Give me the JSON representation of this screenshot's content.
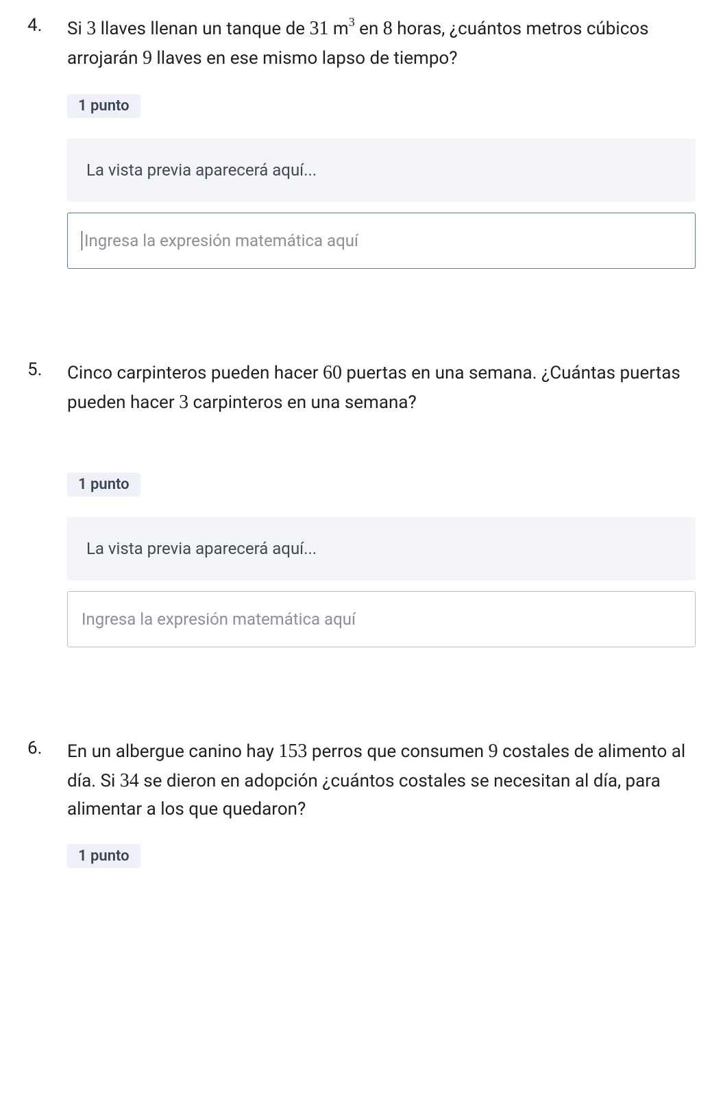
{
  "questions": [
    {
      "number": "4.",
      "text_parts": {
        "p1": "Si ",
        "n1": "3",
        "p2": " llaves llenan un tanque de ",
        "n2": "31",
        "p3": " m",
        "sup": "3",
        "p4": " en ",
        "n3": "8",
        "p5": " horas, ¿cuántos metros cúbicos arrojarán ",
        "n4": "9",
        "p6": " llaves en ese mismo lapso de tiempo?"
      },
      "points": "1 punto",
      "preview": "La vista previa aparecerá aquí...",
      "placeholder": "Ingresa la expresión matemática aquí",
      "active": true
    },
    {
      "number": "5.",
      "text_parts": {
        "p1": "Cinco carpinteros pueden hacer ",
        "n1": "60",
        "p2": " puertas en una semana. ¿Cuántas puertas pueden hacer ",
        "n2": "3",
        "p3": " carpinteros en una semana?"
      },
      "points": "1 punto",
      "preview": "La vista previa aparecerá aquí...",
      "placeholder": "Ingresa la expresión matemática aquí",
      "active": false
    },
    {
      "number": "6.",
      "text_parts": {
        "p1": "En un albergue canino hay ",
        "n1": "153",
        "p2": " perros que consumen ",
        "n2": "9",
        "p3": " costales de alimento al día. Si ",
        "n3": "34",
        "p4": " se dieron en adopción ¿cuántos costales se necesitan al día, para alimentar a los que quedaron?"
      },
      "points": "1 punto"
    }
  ]
}
